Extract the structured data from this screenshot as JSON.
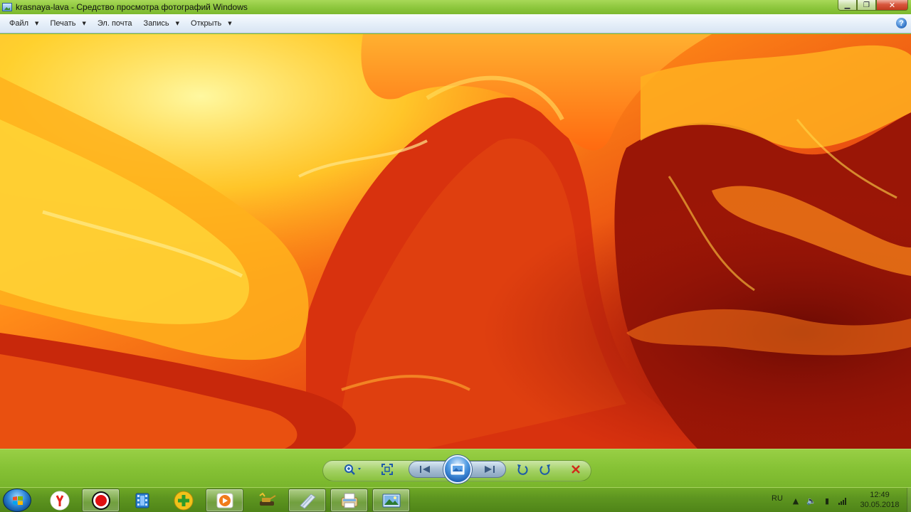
{
  "window": {
    "title": "krasnaya-lava - Средство просмотра фотографий Windows",
    "controls": {
      "minimize": "▁",
      "maximize": "❐",
      "close": "✕"
    }
  },
  "menu": {
    "items": [
      {
        "label": "Файл",
        "has_arrow": true
      },
      {
        "label": "Печать",
        "has_arrow": true
      },
      {
        "label": "Эл. почта",
        "has_arrow": false
      },
      {
        "label": "Запись",
        "has_arrow": true
      },
      {
        "label": "Открыть",
        "has_arrow": true
      }
    ],
    "help": "?"
  },
  "photo": {
    "subject": "abstract red-orange lava fractal",
    "colors": [
      "#ffe24a",
      "#ff9a1a",
      "#e84410",
      "#b81a08",
      "#7a0d04"
    ]
  },
  "controls": {
    "buttons": [
      "zoom-icon",
      "actual-size-icon",
      "previous-icon",
      "slideshow-icon",
      "next-icon",
      "rotate-left-icon",
      "rotate-right-icon",
      "delete-icon"
    ]
  },
  "taskbar": {
    "pinned": [
      "yandex-browser-icon",
      "record-icon",
      "video-editor-icon",
      "plus-app-icon",
      "media-player-icon",
      "tank-game-icon",
      "windows-explorer-icon",
      "printer-folder-icon",
      "photo-viewer-icon"
    ],
    "tray": {
      "language": "RU",
      "time": "12:49",
      "date": "30.05.2018"
    }
  },
  "colors": {
    "titlebar": "#8cc63c",
    "taskbar": "#5e9620",
    "menubar": "#e3edf8",
    "close_button": "#c23a20"
  }
}
